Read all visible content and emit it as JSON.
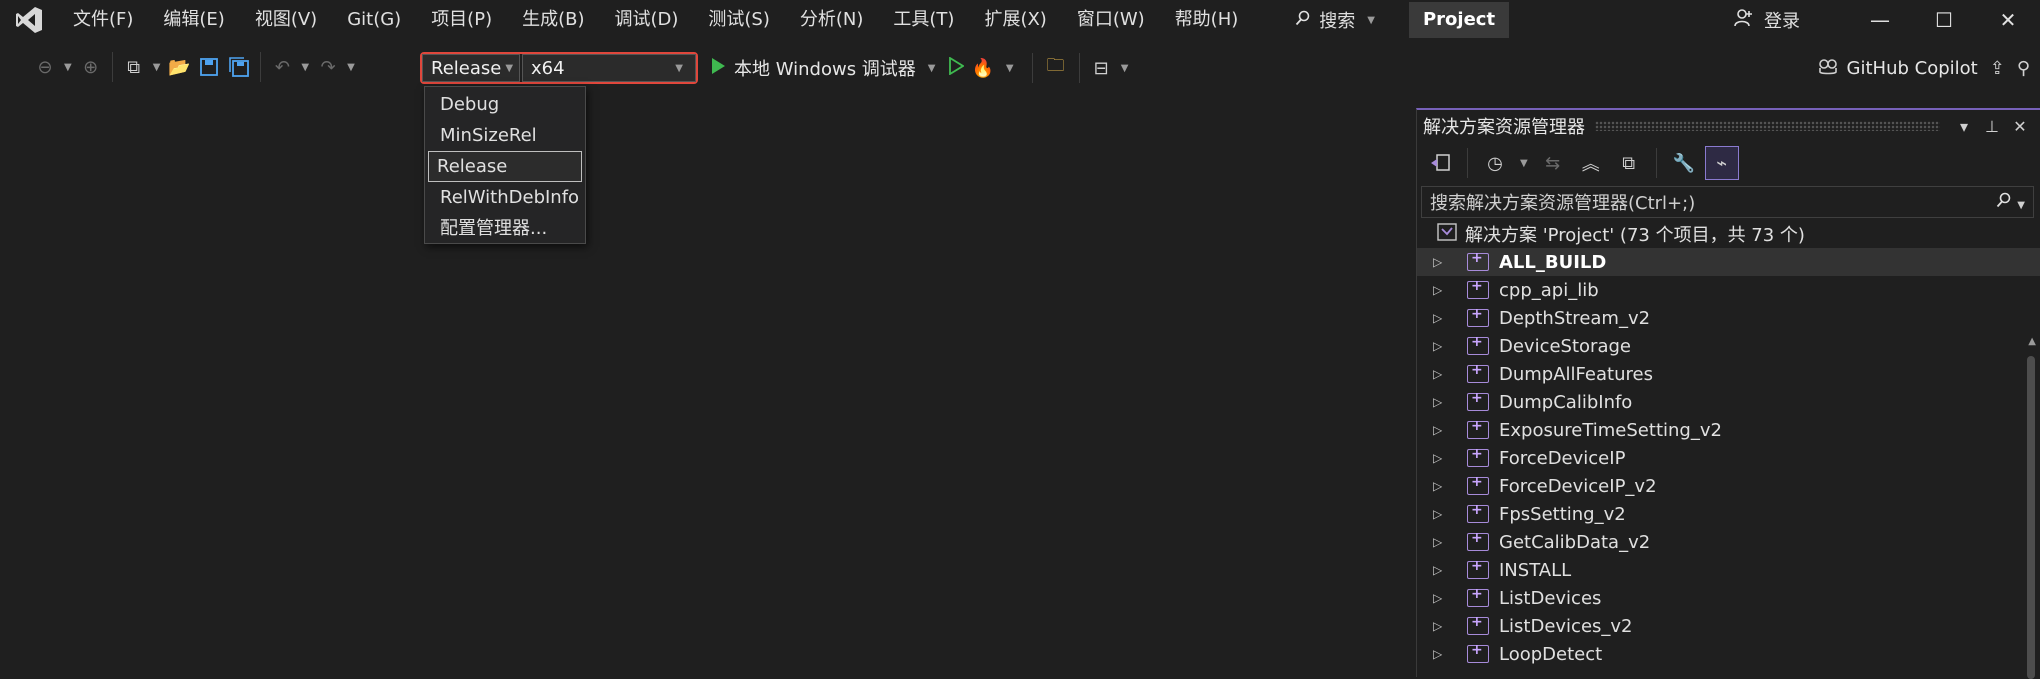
{
  "app": {
    "menu": [
      "文件(F)",
      "编辑(E)",
      "视图(V)",
      "Git(G)",
      "项目(P)",
      "生成(B)",
      "调试(D)",
      "测试(S)",
      "分析(N)",
      "工具(T)",
      "扩展(X)",
      "窗口(W)",
      "帮助(H)"
    ],
    "search_label": "搜索",
    "project_name": "Project",
    "login_label": "登录"
  },
  "toolbar": {
    "configuration": "Release",
    "platform": "x64",
    "run_label": "本地 Windows 调试器",
    "copilot_label": "GitHub Copilot"
  },
  "config_dropdown": {
    "options": [
      "Debug",
      "MinSizeRel",
      "Release",
      "RelWithDebInfo",
      "配置管理器..."
    ],
    "selected": "Release"
  },
  "solution_explorer": {
    "title": "解决方案资源管理器",
    "search_placeholder": "搜索解决方案资源管理器(Ctrl+;)",
    "root": "解决方案 'Project' (73 个项目，共 73 个)",
    "projects": [
      "ALL_BUILD",
      "cpp_api_lib",
      "DepthStream_v2",
      "DeviceStorage",
      "DumpAllFeatures",
      "DumpCalibInfo",
      "ExposureTimeSetting_v2",
      "ForceDeviceIP",
      "ForceDeviceIP_v2",
      "FpsSetting_v2",
      "GetCalibData_v2",
      "INSTALL",
      "ListDevices",
      "ListDevices_v2",
      "LoopDetect"
    ],
    "highlighted": "ALL_BUILD"
  },
  "colors": {
    "accent": "#7761b9",
    "config_border": "#e0473c",
    "run_green": "#3fb950"
  }
}
